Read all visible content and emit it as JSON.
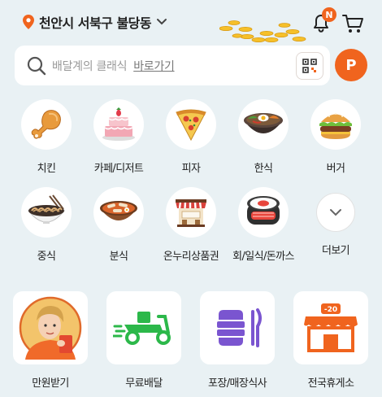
{
  "header": {
    "location": "천안시 서북구 불당동",
    "notification_badge": "N"
  },
  "search": {
    "placeholder": "배달계의 클래식",
    "link_label": "바로가기",
    "profile_initial": "P"
  },
  "categories": [
    {
      "label": "치킨",
      "icon": "chicken-leg-icon"
    },
    {
      "label": "카페/디저트",
      "icon": "cake-icon"
    },
    {
      "label": "피자",
      "icon": "pizza-slice-icon"
    },
    {
      "label": "한식",
      "icon": "bibimbap-icon"
    },
    {
      "label": "버거",
      "icon": "burger-icon"
    },
    {
      "label": "중식",
      "icon": "noodle-bowl-icon"
    },
    {
      "label": "분식",
      "icon": "tteokbokki-icon"
    },
    {
      "label": "온누리상품권",
      "icon": "market-stall-icon"
    },
    {
      "label": "회/일식/돈까스",
      "icon": "sushi-roll-icon"
    },
    {
      "label": "더보기",
      "icon": "chevron-down-icon"
    }
  ],
  "banners": [
    {
      "label": "만원받기",
      "icon": "promo-person-icon"
    },
    {
      "label": "무료배달",
      "icon": "delivery-scooter-icon"
    },
    {
      "label": "포장/매장식사",
      "icon": "takeout-box-icon"
    },
    {
      "label": "전국휴게소",
      "icon": "rest-stop-icon",
      "tag": "-20"
    }
  ],
  "colors": {
    "accent": "#f0641e",
    "background": "#e9f1f4",
    "delivery_green": "#2cb84a",
    "takeout_purple": "#7a55d0"
  }
}
